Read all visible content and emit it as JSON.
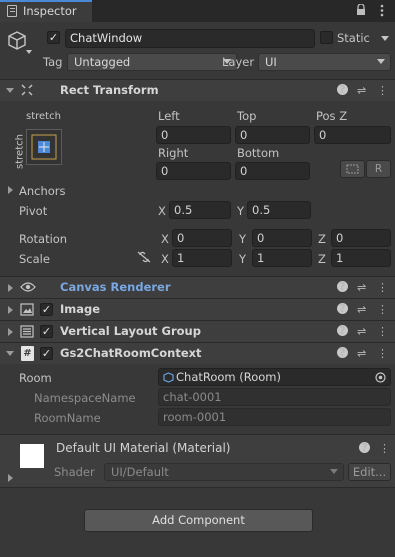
{
  "tab": {
    "title": "Inspector"
  },
  "object": {
    "name": "ChatWindow",
    "static_label": "Static",
    "tag_label": "Tag",
    "tag_value": "Untagged",
    "layer_label": "Layer",
    "layer_value": "UI"
  },
  "rect_transform": {
    "title": "Rect Transform",
    "anchor_top": "stretch",
    "anchor_side": "stretch",
    "left_label": "Left",
    "left": "0",
    "top_label": "Top",
    "top": "0",
    "posz_label": "Pos Z",
    "posz": "0",
    "right_label": "Right",
    "right": "0",
    "bottom_label": "Bottom",
    "bottom": "0",
    "r_button": "R",
    "anchors_label": "Anchors",
    "pivot_label": "Pivot",
    "pivot_x_label": "X",
    "pivot_x": "0.5",
    "pivot_y_label": "Y",
    "pivot_y": "0.5",
    "rotation_label": "Rotation",
    "rot_x_label": "X",
    "rot_x": "0",
    "rot_y_label": "Y",
    "rot_y": "0",
    "rot_z_label": "Z",
    "rot_z": "0",
    "scale_label": "Scale",
    "scale_x_label": "X",
    "scale_x": "1",
    "scale_y_label": "Y",
    "scale_y": "1",
    "scale_z_label": "Z",
    "scale_z": "1"
  },
  "components": {
    "canvas_renderer": "Canvas Renderer",
    "image": "Image",
    "vertical_layout": "Vertical Layout Group",
    "context": "Gs2ChatRoomContext"
  },
  "context": {
    "room_label": "Room",
    "room_value": "ChatRoom (Room)",
    "namespace_label": "NamespaceName",
    "namespace_value": "chat-0001",
    "roomname_label": "RoomName",
    "roomname_value": "room-0001"
  },
  "material": {
    "title": "Default UI Material (Material)",
    "shader_label": "Shader",
    "shader_value": "UI/Default",
    "edit_label": "Edit..."
  },
  "add_component": "Add Component",
  "colors": {
    "accent": "#7aa7e0",
    "background": "#383838",
    "header": "#3e3e3e"
  }
}
